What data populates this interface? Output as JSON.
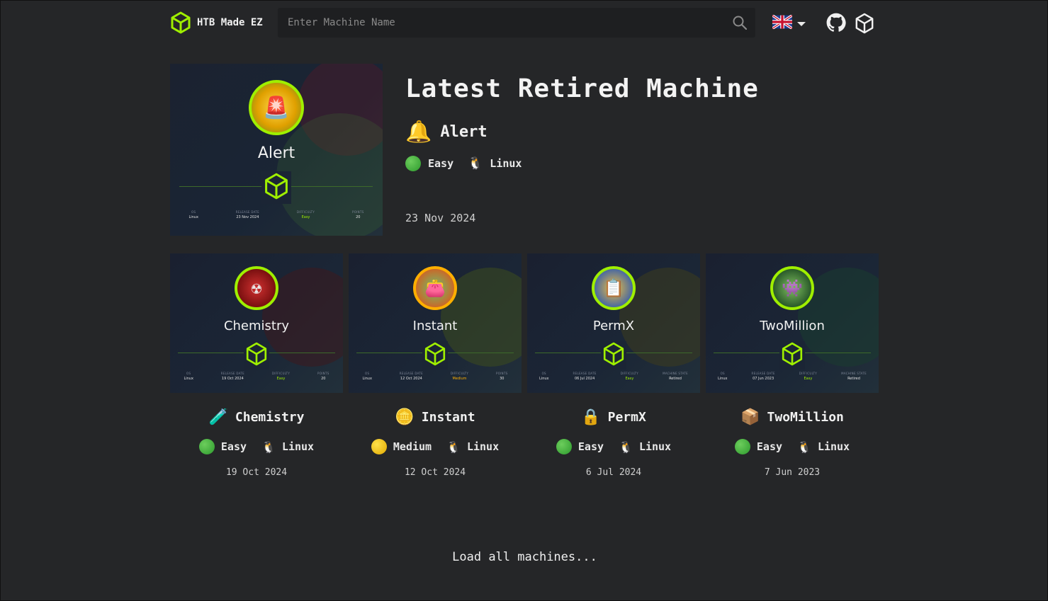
{
  "header": {
    "brand": "HTB Made EZ",
    "search_placeholder": "Enter Machine Name",
    "language": "en-GB"
  },
  "hero": {
    "title": "Latest Retired Machine",
    "icon": "🔔",
    "name": "Alert",
    "difficulty": "Easy",
    "difficulty_color": "#3aa83a",
    "os": "Linux",
    "date": "23 Nov 2024",
    "card": {
      "name": "Alert",
      "stats": [
        {
          "label": "OS",
          "value": "Linux"
        },
        {
          "label": "RELEASE DATE",
          "value": "23 Nov 2024"
        },
        {
          "label": "DIFFICULTY",
          "value": "Easy"
        },
        {
          "label": "POINTS",
          "value": "20"
        }
      ]
    }
  },
  "machines": [
    {
      "name": "Chemistry",
      "icon": "🧪",
      "difficulty": "Easy",
      "difficulty_color": "#3aa83a",
      "os": "Linux",
      "date": "19 Oct 2024",
      "card": {
        "name": "Chemistry",
        "stats": [
          {
            "label": "OS",
            "value": "Linux"
          },
          {
            "label": "RELEASE DATE",
            "value": "19 Oct 2024"
          },
          {
            "label": "DIFFICULTY",
            "value": "Easy"
          },
          {
            "label": "POINTS",
            "value": "20"
          }
        ]
      }
    },
    {
      "name": "Instant",
      "icon": "🪙",
      "difficulty": "Medium",
      "difficulty_color": "#f2c200",
      "os": "Linux",
      "date": "12 Oct 2024",
      "card": {
        "name": "Instant",
        "stats": [
          {
            "label": "OS",
            "value": "Linux"
          },
          {
            "label": "RELEASE DATE",
            "value": "12 Oct 2024"
          },
          {
            "label": "DIFFICULTY",
            "value": "Medium"
          },
          {
            "label": "POINTS",
            "value": "30"
          }
        ]
      }
    },
    {
      "name": "PermX",
      "icon": "🔒",
      "difficulty": "Easy",
      "difficulty_color": "#3aa83a",
      "os": "Linux",
      "date": "6 Jul 2024",
      "card": {
        "name": "PermX",
        "stats": [
          {
            "label": "OS",
            "value": "Linux"
          },
          {
            "label": "RELEASE DATE",
            "value": "06 Jul 2024"
          },
          {
            "label": "DIFFICULTY",
            "value": "Easy"
          },
          {
            "label": "MACHINE STATE",
            "value": "Retired"
          }
        ]
      }
    },
    {
      "name": "TwoMillion",
      "icon": "📦",
      "difficulty": "Easy",
      "difficulty_color": "#3aa83a",
      "os": "Linux",
      "date": "7 Jun 2023",
      "card": {
        "name": "TwoMillion",
        "stats": [
          {
            "label": "OS",
            "value": "Linux"
          },
          {
            "label": "RELEASE DATE",
            "value": "07 Jun 2023"
          },
          {
            "label": "DIFFICULTY",
            "value": "Easy"
          },
          {
            "label": "MACHINE STATE",
            "value": "Retired"
          }
        ]
      }
    }
  ],
  "load_all": "Load all machines...",
  "colors": {
    "accent": "#9fef00",
    "background": "#252628",
    "easy_text": "#9fef00",
    "medium_text": "#ffaf00"
  }
}
